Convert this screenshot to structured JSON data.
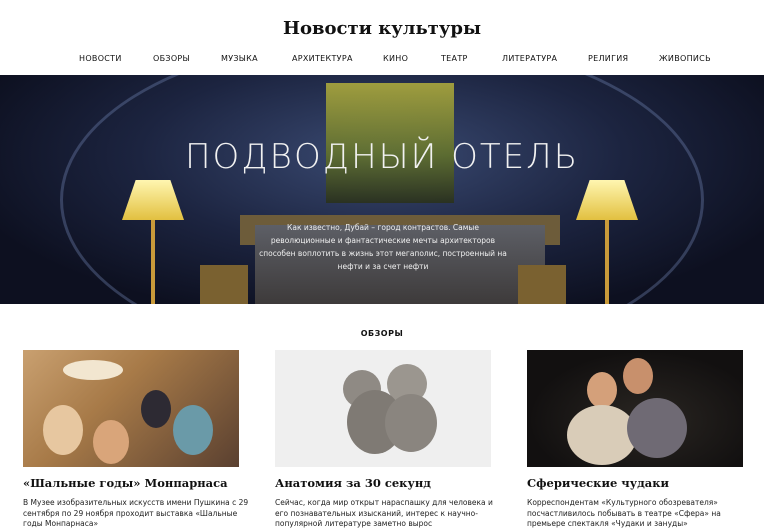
{
  "site": {
    "title": "Новости культуры"
  },
  "nav": {
    "items": [
      {
        "label": "НОВОСТИ"
      },
      {
        "label": "ОБЗОРЫ"
      },
      {
        "label": "МУЗЫКА"
      },
      {
        "label": "АРХИТЕКТУРА"
      },
      {
        "label": "КИНО"
      },
      {
        "label": "ТЕАТР"
      },
      {
        "label": "ЛИТЕРАТУРА"
      },
      {
        "label": "РЕЛИГИЯ"
      },
      {
        "label": "ЖИВОПИСЬ"
      }
    ]
  },
  "hero": {
    "title": "ПОДВОДНЫЙ ОТЕЛЬ",
    "text": "Как известно, Дубай – город контрастов. Самые революционные и фантастические мечты архитекторов способен воплотить в жизнь этот мегаполис, построенный на нефти и за счет нефти"
  },
  "section": {
    "label": "ОБЗОРЫ"
  },
  "cards": [
    {
      "title": "«Шальные годы» Монпарнаса",
      "text": "В Музее изобразительных искусств имени Пушкина с 29 сентября по 29 ноября проходит выставка «Шальные годы Монпарнаса»"
    },
    {
      "title": "Анатомия за 30 секунд",
      "text": "Сейчас, когда мир открыт нараспашку для человека и его познавательных изысканий, интерес к научно-популярной литературе заметно вырос"
    },
    {
      "title": "Сферические чудаки",
      "text": "Корреспондентам «Культурного обозревателя» посчастливилось побывать в театре «Сфера» на премьере спектакля «Чудаки и зануды»"
    }
  ]
}
